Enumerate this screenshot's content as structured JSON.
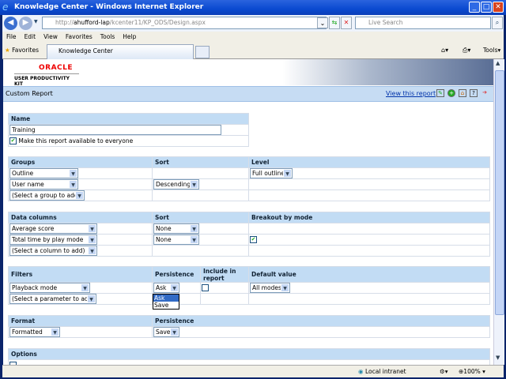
{
  "window": {
    "title": "Knowledge Center - Windows Internet Explorer"
  },
  "address": {
    "prefix": "http://",
    "host": "ahufford-lap",
    "path": "/kcenter11/KP_ODS/Design.aspx"
  },
  "search": {
    "placeholder": "Live Search"
  },
  "menu": [
    "File",
    "Edit",
    "View",
    "Favorites",
    "Tools",
    "Help"
  ],
  "favorites_label": "Favorites",
  "tab_label": "Knowledge Center",
  "tools_label": "Tools",
  "brand": {
    "oracle": "ORACLE",
    "product": "USER PRODUCTIVITY KIT"
  },
  "page": {
    "title": "Custom Report",
    "view_link": "View this report"
  },
  "name_section": {
    "header": "Name",
    "value": "Training",
    "share_label": "Make this report available to everyone",
    "shared": true
  },
  "groups": {
    "headers": [
      "Groups",
      "Sort",
      "Level"
    ],
    "rows": [
      {
        "group": "Outline",
        "sort": "",
        "level": "Full outline"
      },
      {
        "group": "User name",
        "sort": "Descending",
        "level": ""
      },
      {
        "group": "(Select a group to add)",
        "sort": "",
        "level": ""
      }
    ]
  },
  "data_columns": {
    "headers": [
      "Data columns",
      "Sort",
      "Breakout by mode"
    ],
    "rows": [
      {
        "column": "Average score",
        "sort": "None",
        "breakout": false
      },
      {
        "column": "Total time by play mode",
        "sort": "None",
        "breakout": true
      },
      {
        "column": "(Select a column to add)"
      }
    ]
  },
  "filters": {
    "headers": [
      "Filters",
      "Persistence",
      "Include in report",
      "Default value"
    ],
    "rows": [
      {
        "filter": "Playback mode",
        "persistence": "Ask",
        "include": false,
        "default": "All modes"
      },
      {
        "filter": "(Select a parameter to add)"
      }
    ],
    "dropdown_options": [
      "Ask",
      "Save"
    ],
    "dropdown_selected": "Ask"
  },
  "format": {
    "headers": [
      "Format",
      "Persistence"
    ],
    "value": "Formatted",
    "persistence": "Save"
  },
  "options": {
    "header": "Options"
  },
  "status": {
    "zone": "Local intranet",
    "zoom": "100%"
  }
}
